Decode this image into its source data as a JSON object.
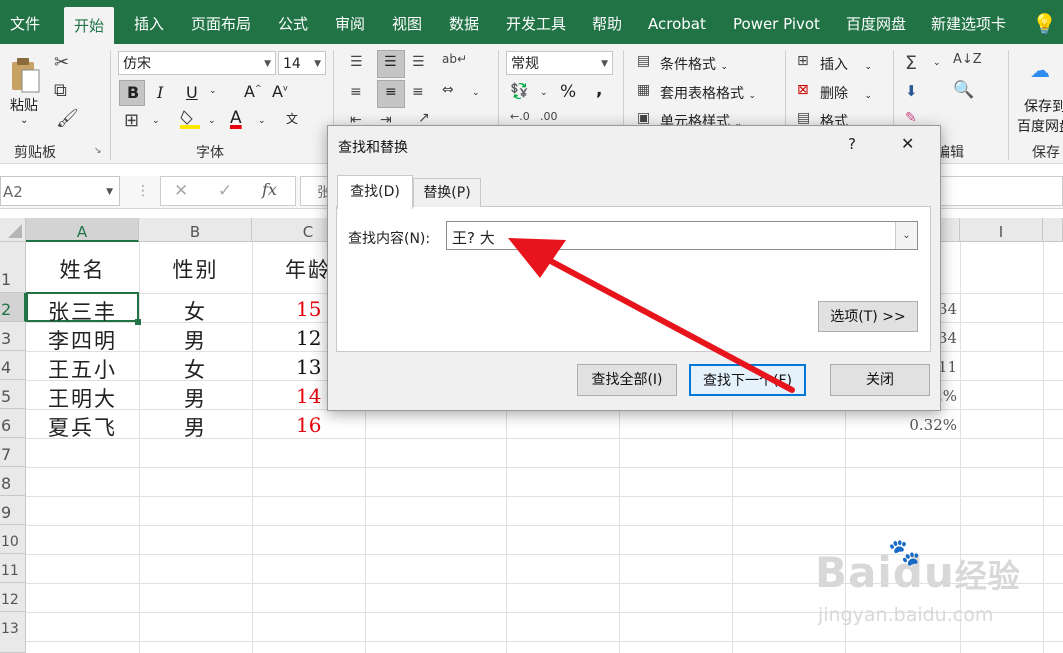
{
  "ribbon_tabs": [
    "文件",
    "开始",
    "插入",
    "页面布局",
    "公式",
    "审阅",
    "视图",
    "数据",
    "开发工具",
    "帮助",
    "Acrobat",
    "Power Pivot",
    "百度网盘",
    "新建选项卡"
  ],
  "active_tab": "开始",
  "ribbon": {
    "paste_label": "粘贴",
    "clipboard_group": "剪贴板",
    "font_name": "仿宋",
    "font_size": "14",
    "font_group": "字体",
    "number_format": "常规",
    "conditional_format": "条件格式",
    "table_format": "套用表格格式",
    "cell_style": "单元格样式",
    "insert_label": "插入",
    "delete_label": "删除",
    "format_label": "格式",
    "edit_group": "编辑",
    "save_to_label_1": "保存到",
    "save_to_label_2": "百度网盘",
    "save_group": "保存",
    "bold": "B",
    "italic": "I",
    "underline": "U",
    "font_color_letter": "A",
    "wen": "文",
    "percent": "%",
    "comma": ","
  },
  "formula_bar": {
    "name_box": "A2",
    "fx": "fx",
    "content_fragment": "张"
  },
  "columns": [
    "A",
    "B",
    "C",
    "I"
  ],
  "rows": [
    "1",
    "2",
    "3",
    "4",
    "5",
    "6",
    "7",
    "8",
    "9",
    "10",
    "11",
    "12",
    "13"
  ],
  "table": {
    "header": [
      "姓名",
      "性别",
      "年龄"
    ],
    "rows": [
      {
        "name": "张三丰",
        "gender": "女",
        "age": "15",
        "pct": "34"
      },
      {
        "name": "李四明",
        "gender": "男",
        "age": "12",
        "pct": "34"
      },
      {
        "name": "王五小",
        "gender": "女",
        "age": "13",
        "pct": "11"
      },
      {
        "name": "王明大",
        "gender": "男",
        "age": "14",
        "pct": "2%"
      },
      {
        "name": "夏兵飞",
        "gender": "男",
        "age": "16",
        "pct": "0.32%"
      }
    ],
    "red_color": "#e8000b"
  },
  "dialog": {
    "title": "查找和替换",
    "help": "?",
    "close": "✕",
    "tab_find": "查找(D)",
    "tab_replace": "替换(P)",
    "find_label": "查找内容(N):",
    "find_value": "王? 大",
    "options_button": "选项(T) >>",
    "find_all_button": "查找全部(I)",
    "find_next_button": "查找下一个(F)",
    "close_button": "关闭"
  },
  "annotation_color": "#e8141c",
  "watermark": {
    "brand": "Baidu",
    "cn": "经验",
    "url": "jingyan.baidu.com"
  },
  "colors": {
    "excel_green": "#217346",
    "ribbon_bg": "#f3f3f3",
    "header_bg": "#e9e9e9",
    "accent_blue": "#0078d7"
  }
}
